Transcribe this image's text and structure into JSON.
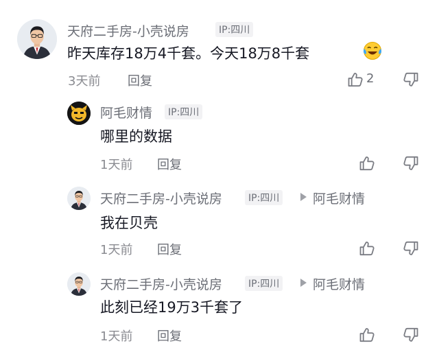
{
  "comments": [
    {
      "author": "天府二手房-小壳说房",
      "ip": "IP:四川",
      "text": "昨天库存18万4千套。今天18万8千套",
      "emoji_icon": "laughing-tears-emoji-icon",
      "time": "3天前",
      "reply_label": "回复",
      "like_count": "2"
    },
    {
      "author": "阿毛财情",
      "ip": "IP:四川",
      "text": "哪里的数据",
      "time": "1天前",
      "reply_label": "回复"
    },
    {
      "author": "天府二手房-小壳说房",
      "ip": "IP:四川",
      "reply_to": "阿毛财情",
      "text": "我在贝壳",
      "time": "1天前",
      "reply_label": "回复"
    },
    {
      "author": "天府二手房-小壳说房",
      "ip": "IP:四川",
      "reply_to": "阿毛财情",
      "text": "此刻已经19万3千套了",
      "time": "1天前",
      "reply_label": "回复"
    }
  ],
  "icons": {
    "like": "thumbs-up-icon",
    "dislike": "thumbs-down-icon",
    "reply_arrow": "reply-arrow-icon"
  },
  "colors": {
    "name": "#6b6e76",
    "text": "#161823",
    "meta": "#8a8b91",
    "ip_badge_bg": "#f2f2f4"
  }
}
